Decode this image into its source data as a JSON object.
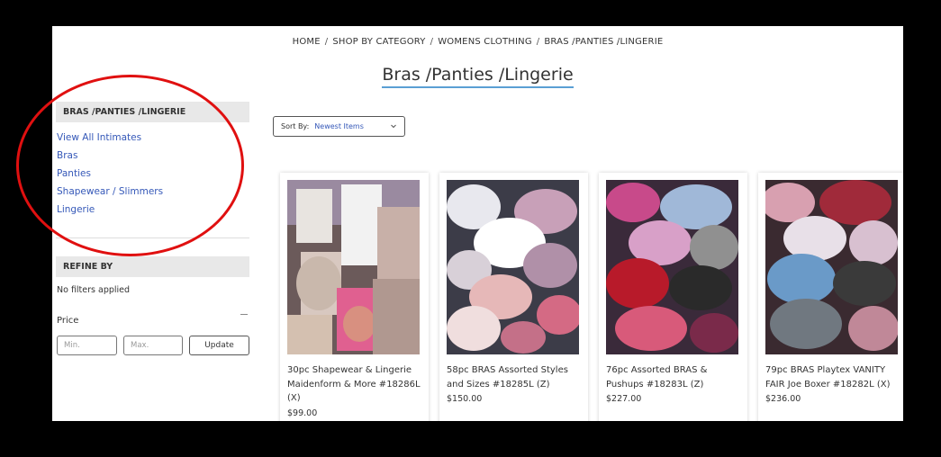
{
  "breadcrumb": {
    "items": [
      "HOME",
      "SHOP BY CATEGORY",
      "WOMENS CLOTHING",
      "BRAS /PANTIES /LINGERIE"
    ],
    "separator": "/"
  },
  "page_title": "Bras /Panties /Lingerie",
  "sidebar": {
    "category_heading": "BRAS /PANTIES /LINGERIE",
    "links": [
      "View All Intimates",
      "Bras",
      "Panties",
      "Shapewear / Slimmers",
      "Lingerie"
    ],
    "refine_heading": "REFINE BY",
    "no_filters": "No filters applied",
    "price_label": "Price",
    "min_placeholder": "Min.",
    "max_placeholder": "Max.",
    "update_button": "Update",
    "link_color": "#3558b8"
  },
  "sort": {
    "label": "Sort By:",
    "value": "Newest Items",
    "icon": "chevron-down-icon"
  },
  "products": [
    {
      "title": "30pc Shapewear & Lingerie Maidenform & More #18286L (X)",
      "price": "$99.00"
    },
    {
      "title": "58pc BRAS Assorted Styles and Sizes #18285L (Z)",
      "price": "$150.00"
    },
    {
      "title": "76pc Assorted BRAS & Pushups #18283L (Z)",
      "price": "$227.00"
    },
    {
      "title": "79pc BRAS Playtex VANITY FAIR Joe Boxer #18282L (X)",
      "price": "$236.00"
    }
  ],
  "annotation_color": "#e01010"
}
